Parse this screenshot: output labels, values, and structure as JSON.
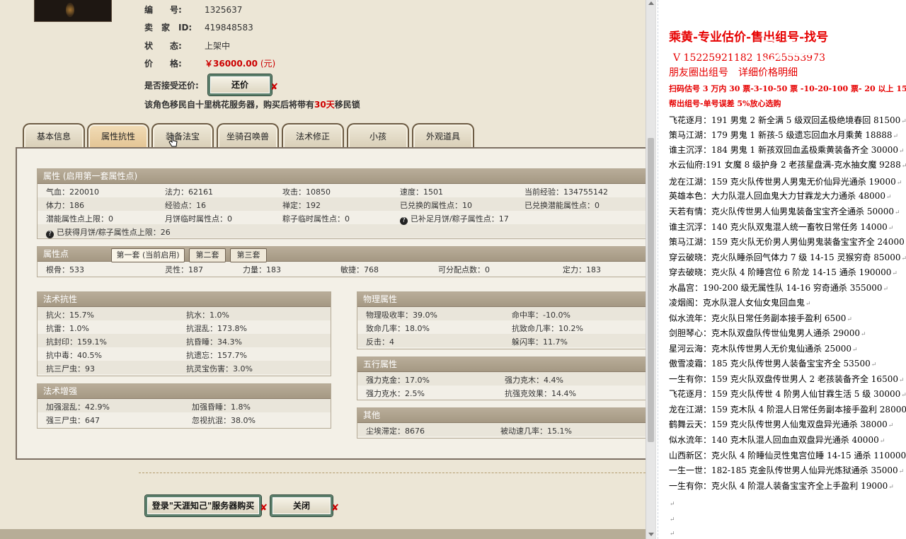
{
  "listing": {
    "number_label": "编　　号:",
    "number_value": "1325637",
    "seller_label": "卖　家　ID:",
    "seller_value": "419848583",
    "status_label": "状　　态:",
    "status_value": "上架中",
    "price_label": "价　　格:",
    "price_value": "￥36000.00",
    "price_unit": "(元)",
    "bargain_label": "是否接受还价:",
    "bargain_button": "还价",
    "migration_note_prefix": "该角色移民自十里桃花服务器，购买后将带有",
    "migration_days": "30天",
    "migration_note_suffix": "移民锁"
  },
  "tabs": [
    "基本信息",
    "属性抗性",
    "装备法宝",
    "坐骑召唤兽",
    "法术修正",
    "小孩",
    "外观道具"
  ],
  "attributes": {
    "title": "属性 (启用第一套属性点)",
    "rows": [
      [
        "气血：220010",
        "法力：62161",
        "攻击：10850",
        "速度：1501",
        "当前经验：134755142"
      ],
      [
        "体力：186",
        "经验点：16",
        "禅定：192",
        "已兑换的属性点：10",
        "已兑换潜能属性点：0"
      ],
      [
        "潜能属性点上限：0",
        "月饼临时属性点：0",
        "粽子临时属性点：0",
        "已补足月饼/粽子属性点：17",
        ""
      ],
      [
        "已获得月饼/粽子属性点上限：26"
      ]
    ]
  },
  "points": {
    "title": "属性点",
    "subtabs": [
      "第一套 (当前启用)",
      "第二套",
      "第三套"
    ],
    "row": [
      "根骨：533",
      "灵性：187",
      "力量：183",
      "敏捷：768",
      "可分配点数：0",
      "定力：183"
    ]
  },
  "spell_resist": {
    "title": "法术抗性",
    "rows": [
      [
        "抗火：15.7%",
        "抗水：1.0%"
      ],
      [
        "抗雷：1.0%",
        "抗混乱：173.8%"
      ],
      [
        "抗封印：159.1%",
        "抗昏睡：34.3%"
      ],
      [
        "抗中毒：40.5%",
        "抗遗忘：157.7%"
      ],
      [
        "抗三尸虫：93",
        "抗灵宝伤害：3.0%"
      ]
    ]
  },
  "spell_boost": {
    "title": "法术增强",
    "rows": [
      [
        "加强混乱：42.9%",
        "加强昏睡：1.8%"
      ],
      [
        "强三尸虫：647",
        "忽视抗混：38.0%"
      ]
    ]
  },
  "physical": {
    "title": "物理属性",
    "rows": [
      [
        "物理吸收率：39.0%",
        "命中率：-10.0%"
      ],
      [
        "致命几率：18.0%",
        "抗致命几率：10.2%"
      ],
      [
        "反击：4",
        "躲闪率：11.7%"
      ]
    ]
  },
  "five_elements": {
    "title": "五行属性",
    "rows": [
      [
        "强力克金：17.0%",
        "强力克木：4.4%"
      ],
      [
        "强力克水：2.5%",
        "抗强克效果：14.4%"
      ]
    ]
  },
  "other": {
    "title": "其他",
    "rows": [
      [
        "尘埃滞定：8676",
        "被动速几率：15.1%"
      ]
    ]
  },
  "buttons": {
    "buy": "登录\"天涯知己\"服务器购买",
    "close": "关闭"
  },
  "watermark": "国画",
  "price_list": {
    "title": "乘黄-专业估价-售出组号-找号",
    "phone": "V 15225921182   18625553973",
    "moments": "朋友圈出组号　详细价格明细",
    "scan_line": "扫码估号 3 万内 30 票-3-10-50 票  -10-20-100 票- 20 以上 150",
    "help_line": "帮出组号-单号误差 5%放心选购",
    "items": [
      "飞花逐月：191 男鬼 2 新全满 5 级双回孟极绝境春回 81500",
      "策马江湖：179 男鬼 1 新孩-5 级遗忘回血水月乘黄 18888",
      "谁主沉浮：184 男鬼 1 新孩双回血孟极乘黄装备齐全 30000",
      "水云仙府:191 女魔 8 级护身 2 老孩星盘满-克水抽女魔 9288",
      "龙在江湖：159 克火队传世男人男鬼无价仙异光通杀 19000",
      "英雄本色：大力队混人回血鬼大力甘霖龙大力通杀 48000",
      "天若有情：克火队传世男人仙男鬼装备宝宝齐全通杀 50000",
      "谁主沉浮：140 克火队双鬼混人统一畜牧日常任务 14000",
      "策马江湖：159 克火队无价男人男仙男鬼装备宝宝齐全 24000",
      "穿云破晓：克火队睡杀回气体力 7 级 14-15 灵猴穷奇 85000",
      "穿去破晓：克火队 4 阶睡宫位 6 阶龙 14-15 通杀 190000",
      "水晶宫：190-200 级无属性队 14-16 穷奇通杀 355000",
      "凌烟阁：克水队混人女仙女鬼回血鬼",
      "似水流年：克火队日常任务副本接手盈利 6500",
      "剑胆琴心：克木队双盘队传世仙鬼男人通杀 29000",
      "星河云海：克木队传世男人无价鬼仙通杀 25000",
      "傲雪凌霜：185 克火队传世男人装备宝宝齐全 53500",
      "一生有你：159 克火队双盘传世男人 2 老孩装备齐全 16500",
      "飞花逐月：159 克火队传世 4 阶男人仙甘霖生活 5 级 30000",
      "龙在江湖：159 克木队 4 阶混人日常任务副本接手盈利 28000",
      "鹤舞云天：159 克火队传世男人仙鬼双盘异光通杀 38000",
      "似水流年：140 克木队混人回血血双盘异光通杀 40000",
      "山西新区：克火队 4 阶睡仙灵性鬼宫位睡 14-15 通杀 110000",
      "一生一世：182-185 克金队传世男人仙异光炼狱通杀 35000",
      "一生有你：克火队 4 阶混人装备宝宝齐全上手盈利 19000"
    ]
  }
}
